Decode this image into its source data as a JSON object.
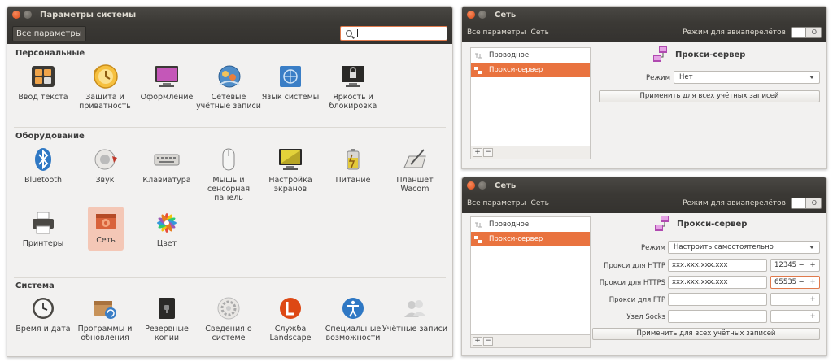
{
  "settings": {
    "title": "Параметры системы",
    "all_settings": "Все параметры",
    "sections": {
      "personal": "Персональные",
      "hardware": "Оборудование",
      "system": "Система"
    },
    "personal_items": [
      {
        "label": "Ввод текста",
        "icon": "keyboard-input-icon"
      },
      {
        "label": "Защита и приватность",
        "icon": "security-privacy-icon"
      },
      {
        "label": "Оформление",
        "icon": "appearance-icon"
      },
      {
        "label": "Сетевые учётные записи",
        "icon": "online-accounts-icon"
      },
      {
        "label": "Язык системы",
        "icon": "language-icon"
      },
      {
        "label": "Яркость и блокировка",
        "icon": "brightness-lock-icon"
      }
    ],
    "hardware_items": [
      {
        "label": "Bluetooth",
        "icon": "bluetooth-icon"
      },
      {
        "label": "Звук",
        "icon": "sound-icon"
      },
      {
        "label": "Клавиатура",
        "icon": "keyboard-icon"
      },
      {
        "label": "Мышь и сенсорная панель",
        "icon": "mouse-icon"
      },
      {
        "label": "Настройка экранов",
        "icon": "displays-icon"
      },
      {
        "label": "Питание",
        "icon": "power-icon"
      },
      {
        "label": "Планшет Wacom",
        "icon": "wacom-tablet-icon"
      },
      {
        "label": "Принтеры",
        "icon": "printer-icon"
      },
      {
        "label": "Сеть",
        "icon": "network-icon"
      },
      {
        "label": "Цвет",
        "icon": "color-icon"
      }
    ],
    "system_items": [
      {
        "label": "Время и дата",
        "icon": "clock-icon"
      },
      {
        "label": "Программы и обновления",
        "icon": "software-updates-icon"
      },
      {
        "label": "Резервные копии",
        "icon": "backup-icon"
      },
      {
        "label": "Сведения о системе",
        "icon": "system-details-icon"
      },
      {
        "label": "Служба Landscape",
        "icon": "landscape-icon"
      },
      {
        "label": "Специальные возможности",
        "icon": "accessibility-icon"
      },
      {
        "label": "Учётные записи",
        "icon": "user-accounts-icon"
      }
    ]
  },
  "network_top": {
    "title": "Сеть",
    "crumb_all": "Все параметры",
    "crumb_net": "Сеть",
    "airplane": "Режим для авиаперелётов",
    "toggle_state": "O",
    "devices": [
      "Проводное",
      "Прокси-сервер"
    ],
    "proxy_title": "Прокси-сервер",
    "mode_label": "Режим",
    "mode_value": "Нет",
    "apply": "Применить для всех учётных записей"
  },
  "network_bottom": {
    "title": "Сеть",
    "crumb_all": "Все параметры",
    "crumb_net": "Сеть",
    "airplane": "Режим для авиаперелётов",
    "toggle_state": "O",
    "devices": [
      "Проводное",
      "Прокси-сервер"
    ],
    "proxy_title": "Прокси-сервер",
    "mode_label": "Режим",
    "mode_value": "Настроить самостоятельно",
    "http_label": "Прокси для HTTP",
    "http_value": "xxx.xxx.xxx.xxx",
    "http_port": "12345",
    "https_label": "Прокси для HTTPS",
    "https_value": "xxx.xxx.xxx.xxx",
    "https_port": "65535",
    "ftp_label": "Прокси для FTP",
    "socks_label": "Узел Socks",
    "apply": "Применить для всех учётных записей"
  },
  "colors": {
    "accent": "#e9733f",
    "titlebar": "#3b3935",
    "selected_bg": "#f4c7b6"
  }
}
